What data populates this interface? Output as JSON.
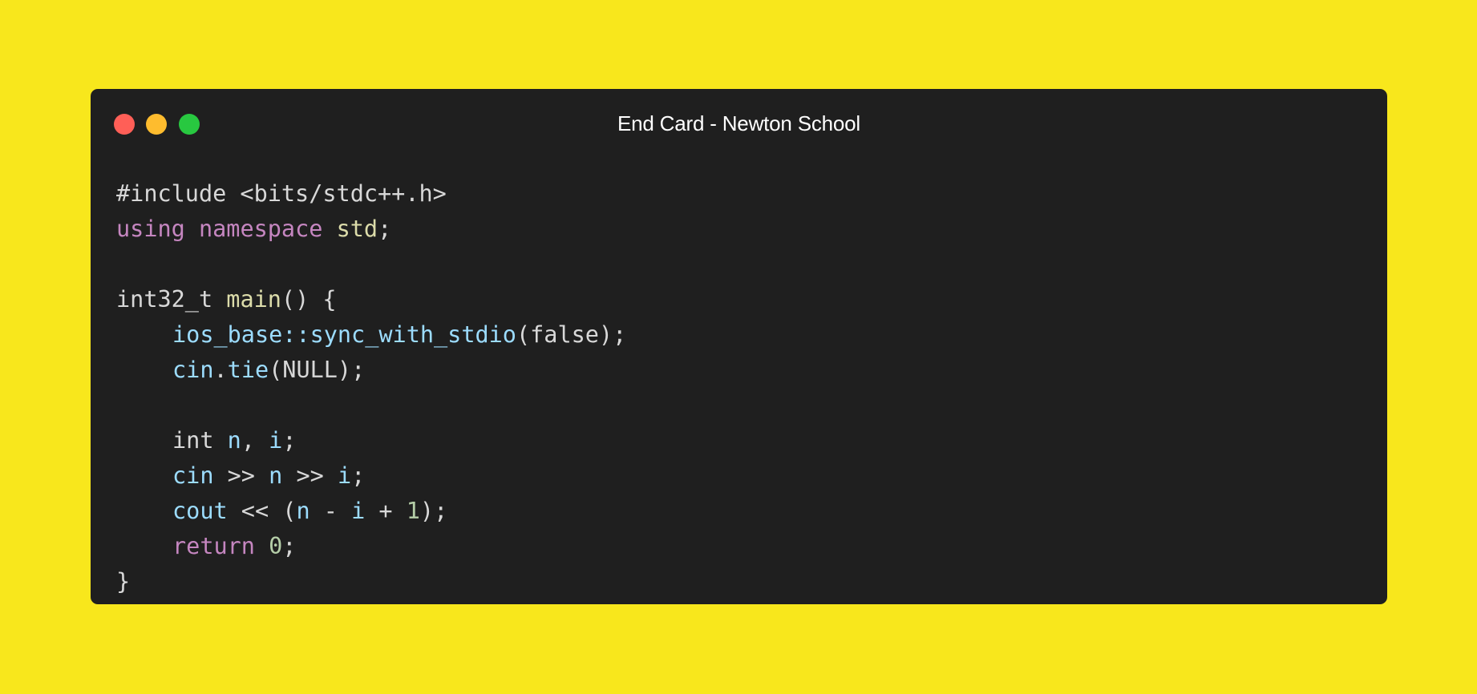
{
  "colors": {
    "background": "#f8e71c",
    "window": "#1f1f1f",
    "title": "#ffffff",
    "traffic_close": "#ff5f57",
    "traffic_minimize": "#febc2e",
    "traffic_maximize": "#28c840",
    "plain": "#d8d8d8",
    "keyword": "#c586c0",
    "type_name": "#dcdcaa",
    "identifier": "#9cdcfe",
    "number": "#b5cea8"
  },
  "window": {
    "title": "End Card - Newton School"
  },
  "code": {
    "lines": [
      {
        "indent": 0,
        "tokens": [
          {
            "text": "#include <bits/stdc++.h>",
            "kind": "plain"
          }
        ]
      },
      {
        "indent": 0,
        "tokens": [
          {
            "text": "using",
            "kind": "keyword"
          },
          {
            "text": " ",
            "kind": "plain"
          },
          {
            "text": "namespace",
            "kind": "keyword"
          },
          {
            "text": " ",
            "kind": "plain"
          },
          {
            "text": "std",
            "kind": "type_name"
          },
          {
            "text": ";",
            "kind": "plain"
          }
        ]
      },
      {
        "indent": 0,
        "tokens": []
      },
      {
        "indent": 0,
        "tokens": [
          {
            "text": "int32_t ",
            "kind": "plain"
          },
          {
            "text": "main",
            "kind": "type_name"
          },
          {
            "text": "() {",
            "kind": "plain"
          }
        ]
      },
      {
        "indent": 1,
        "tokens": [
          {
            "text": "ios_base::sync_with_stdio",
            "kind": "identifier"
          },
          {
            "text": "(false);",
            "kind": "plain"
          }
        ]
      },
      {
        "indent": 1,
        "tokens": [
          {
            "text": "cin",
            "kind": "identifier"
          },
          {
            "text": ".",
            "kind": "plain"
          },
          {
            "text": "tie",
            "kind": "identifier"
          },
          {
            "text": "(NULL);",
            "kind": "plain"
          }
        ]
      },
      {
        "indent": 0,
        "tokens": []
      },
      {
        "indent": 1,
        "tokens": [
          {
            "text": "int",
            "kind": "plain"
          },
          {
            "text": " ",
            "kind": "plain"
          },
          {
            "text": "n",
            "kind": "identifier"
          },
          {
            "text": ", ",
            "kind": "plain"
          },
          {
            "text": "i",
            "kind": "identifier"
          },
          {
            "text": ";",
            "kind": "plain"
          }
        ]
      },
      {
        "indent": 1,
        "tokens": [
          {
            "text": "cin",
            "kind": "identifier"
          },
          {
            "text": " >> ",
            "kind": "plain"
          },
          {
            "text": "n",
            "kind": "identifier"
          },
          {
            "text": " >> ",
            "kind": "plain"
          },
          {
            "text": "i",
            "kind": "identifier"
          },
          {
            "text": ";",
            "kind": "plain"
          }
        ]
      },
      {
        "indent": 1,
        "tokens": [
          {
            "text": "cout",
            "kind": "identifier"
          },
          {
            "text": " << (",
            "kind": "plain"
          },
          {
            "text": "n",
            "kind": "identifier"
          },
          {
            "text": " - ",
            "kind": "plain"
          },
          {
            "text": "i",
            "kind": "identifier"
          },
          {
            "text": " + ",
            "kind": "plain"
          },
          {
            "text": "1",
            "kind": "number"
          },
          {
            "text": ");",
            "kind": "plain"
          }
        ]
      },
      {
        "indent": 1,
        "tokens": [
          {
            "text": "return",
            "kind": "keyword"
          },
          {
            "text": " ",
            "kind": "plain"
          },
          {
            "text": "0",
            "kind": "number"
          },
          {
            "text": ";",
            "kind": "plain"
          }
        ]
      },
      {
        "indent": 0,
        "tokens": [
          {
            "text": "}",
            "kind": "plain"
          }
        ]
      }
    ]
  }
}
